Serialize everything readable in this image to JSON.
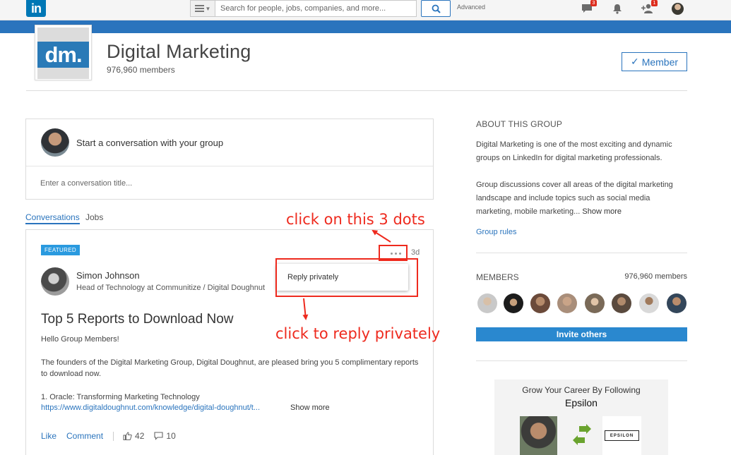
{
  "topbar": {
    "logo_text": "in",
    "search_placeholder": "Search for people, jobs, companies, and more...",
    "advanced_label": "Advanced",
    "messages_badge": "3",
    "connections_badge": "1"
  },
  "group": {
    "logo_text": "dm.",
    "title": "Digital Marketing",
    "members": "976,960 members",
    "member_button": "Member"
  },
  "compose": {
    "prompt": "Start a conversation with your group",
    "title_placeholder": "Enter a conversation title..."
  },
  "tabs": [
    "Conversations",
    "Jobs"
  ],
  "post": {
    "badge": "FEATURED",
    "age": "3d",
    "author_name": "Simon Johnson",
    "author_headline": "Head of Technology at Communitize / Digital Doughnut",
    "title": "Top 5 Reports to Download Now",
    "greeting": "Hello Group Members!",
    "body": "The founders of the Digital Marketing Group, Digital Doughnut, are pleased bring you 5 complimentary reports to download now.",
    "list_item": "1. Oracle: Transforming Marketing Technology",
    "link": "https://www.digitaldoughnut.com/knowledge/digital-doughnut/t...",
    "show_more": "Show more",
    "like_label": "Like",
    "comment_label": "Comment",
    "likes_count": "42",
    "comments_count": "10"
  },
  "dropdown": {
    "reply_privately": "Reply privately"
  },
  "annotations": {
    "dots_hint": "click on this 3 dots",
    "reply_hint": "click to reply privately",
    "color": "#ee2a1e"
  },
  "about": {
    "heading": "ABOUT THIS GROUP",
    "paragraph1": "Digital Marketing is one of the most exciting and dynamic groups on LinkedIn for digital marketing professionals.",
    "paragraph2": "Group discussions cover all areas of the digital marketing landscape and include topics such as social media marketing, mobile marketing...",
    "show_more": "Show more",
    "group_rules": "Group rules"
  },
  "members_panel": {
    "heading": "MEMBERS",
    "count": "976,960 members",
    "invite_button": "Invite others"
  },
  "ad": {
    "line1": "Grow Your Career By Following",
    "line2": "Epsilon",
    "logo_text": "EPSILON"
  },
  "colors": {
    "accent": "#2a74bd",
    "band": "#2a74bd",
    "annotation": "#ee2a1e"
  }
}
